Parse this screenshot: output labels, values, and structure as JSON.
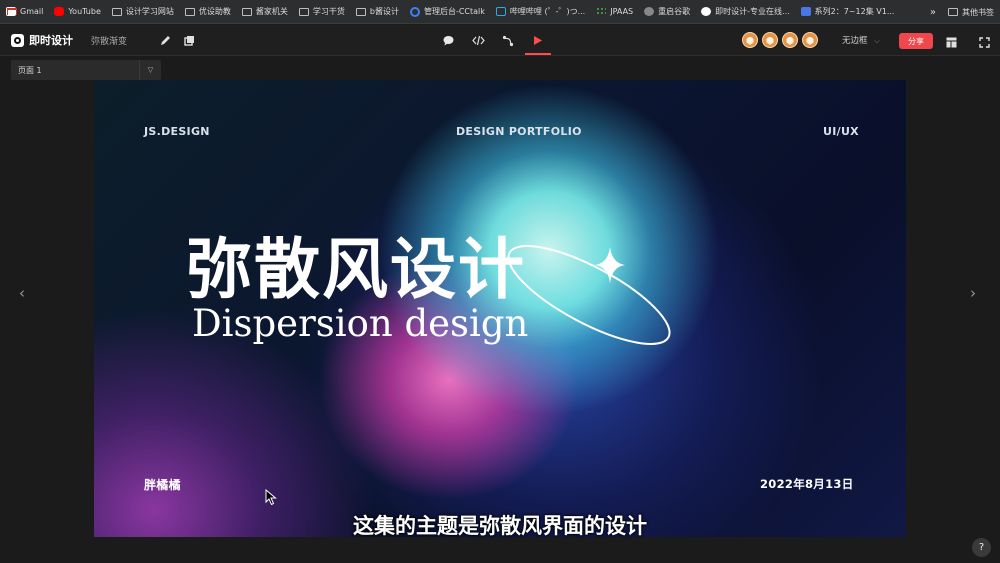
{
  "bookmarks": {
    "items": [
      {
        "label": "Gmail",
        "icon": "gmail-icon"
      },
      {
        "label": "YouTube",
        "icon": "youtube-icon"
      },
      {
        "label": "设计学习网站",
        "icon": "folder-icon"
      },
      {
        "label": "优设助教",
        "icon": "folder-icon"
      },
      {
        "label": "酱家机关",
        "icon": "folder-icon"
      },
      {
        "label": "学习干货",
        "icon": "folder-icon"
      },
      {
        "label": "b酱设计",
        "icon": "folder-icon"
      },
      {
        "label": "管理后台-CCtalk",
        "icon": "loading-circle-icon"
      },
      {
        "label": "哔哩哔哩 (゜-゜)つ...",
        "icon": "bilibili-icon"
      },
      {
        "label": "JPAAS",
        "icon": "grid-icon"
      },
      {
        "label": "重启谷歌",
        "icon": "globe-icon"
      },
      {
        "label": "即时设计-专业在线...",
        "icon": "jsdesign-icon"
      },
      {
        "label": "系列2：7~12集 V1...",
        "icon": "doc-icon"
      }
    ],
    "more": "»",
    "other": "其他书签"
  },
  "toolbar": {
    "app_name": "即时设计",
    "doc_name": "弥散渐变",
    "border_option": "无边框",
    "share_label": "分享"
  },
  "page_selector": {
    "value": "页面 1"
  },
  "slide": {
    "top_left": "JS.DESIGN",
    "top_center": "DESIGN PORTFOLIO",
    "top_right": "UI/UX",
    "title_cn": "弥散风设计",
    "title_en": "Dispersion design",
    "author": "胖橘橘",
    "date": "2022年8月13日"
  },
  "subtitle": "这集的主题是弥散风界面的设计",
  "help_label": "?",
  "colors": {
    "accent": "#f0474d",
    "play": "#ff4d4f"
  }
}
